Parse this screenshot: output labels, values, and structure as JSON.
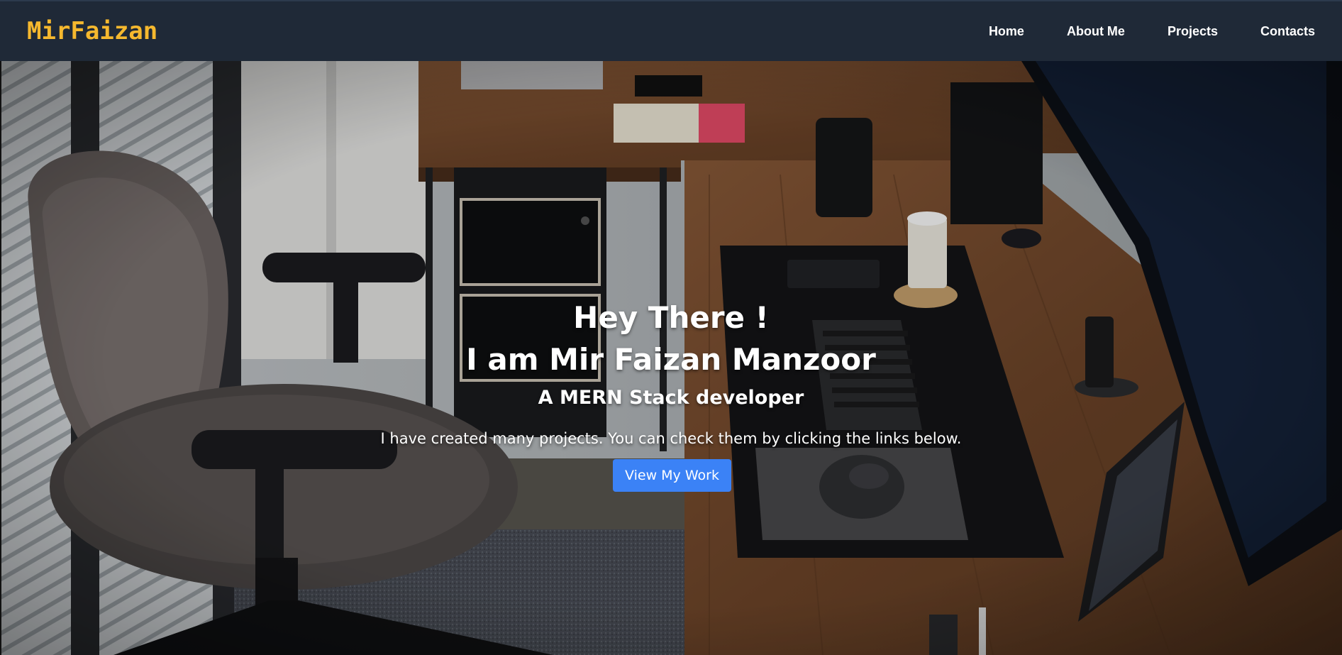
{
  "navbar": {
    "brand": "MirFaizan",
    "links": [
      {
        "label": "Home"
      },
      {
        "label": "About Me"
      },
      {
        "label": "Projects"
      },
      {
        "label": "Contacts"
      }
    ]
  },
  "hero": {
    "greeting": "Hey There !",
    "name_line": "I am Mir Faizan Manzoor",
    "role": "A MERN Stack developer",
    "description": "I have created many projects. You can check them by clicking the links below.",
    "cta_label": "View My Work",
    "background_image": "desk-workspace-photo"
  },
  "colors": {
    "navbar_bg": "#1f2937",
    "brand": "#f5b82e",
    "cta_bg": "#3b82f6",
    "text": "#ffffff"
  }
}
